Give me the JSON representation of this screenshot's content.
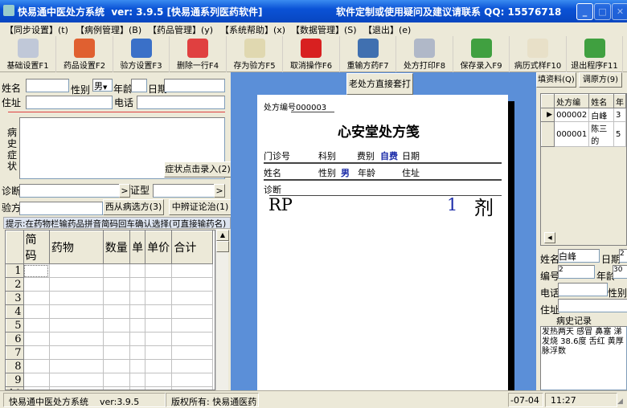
{
  "titlebar": {
    "title": "快易通中医处方系统  ver: 3.9.5 [快易通系列医药软件]",
    "contact": "软件定制或使用疑问及建议请联系 QQ: 15576718"
  },
  "menu": [
    "【同步设置】(t)",
    "【病例管理】(B)",
    "【药品管理】(y)",
    "【系统帮助】(x)",
    "【数据管理】(S)",
    "【退出】(e)"
  ],
  "toolbar": [
    {
      "label": "基础设置F1",
      "icon": "settings-icon",
      "color": "#c0c8d8"
    },
    {
      "label": "药品设置F2",
      "icon": "medicine-icon",
      "color": "#e06030"
    },
    {
      "label": "验方设置F3",
      "icon": "book-icon",
      "color": "#3a70c8"
    },
    {
      "label": "删除一行F4",
      "icon": "delete-row-icon",
      "color": "#e04040"
    },
    {
      "label": "存为验方F5",
      "icon": "save-note-icon",
      "color": "#e0d8b0"
    },
    {
      "label": "取消操作F6",
      "icon": "cancel-icon",
      "color": "#d82020"
    },
    {
      "label": "重输方药F7",
      "icon": "tools-icon",
      "color": "#4070b0"
    },
    {
      "label": "处方打印F8",
      "icon": "printer-icon",
      "color": "#b0b8c8"
    },
    {
      "label": "保存录入F9",
      "icon": "save-icon",
      "color": "#40a040"
    },
    {
      "label": "病历式样F10",
      "icon": "clipboard-icon",
      "color": "#e8e0c8"
    },
    {
      "label": "退出程序F11",
      "icon": "exit-arrow-icon",
      "color": "#40a040"
    }
  ],
  "form": {
    "name_label": "姓名",
    "sex_label": "性别",
    "sex_value": "男",
    "age_label": "年龄",
    "date_label": "日期",
    "address_label": "住址",
    "phone_label": "电话",
    "history_label": "病史症状",
    "symptom_button": "症状点击录入(2)",
    "diagnosis_label": "诊断",
    "syndrome_label": "证型",
    "recipe_label": "验方",
    "western_button": "西从病选方(3)",
    "tcm_button": "中辨证论治(1)",
    "hint": "提示:在药物栏输药品拼音简码回车确认选择(可直接输药名)"
  },
  "grid": {
    "columns": [
      "简码",
      "药物",
      "数量",
      "单",
      "单价",
      "合计"
    ],
    "rows": [
      "1",
      "2",
      "3",
      "4",
      "5",
      "6",
      "7",
      "8",
      "9",
      "10",
      "11"
    ]
  },
  "center": {
    "old_print_button": "老处方直接套打"
  },
  "paper": {
    "number_label": "处方编号",
    "number": "000003",
    "title": "心安堂处方笺",
    "clinic_label": "门诊号",
    "dept_label": "科别",
    "fee_label": "费别",
    "fee_value": "自费",
    "date_label": "日期",
    "name_label": "姓名",
    "sex_label": "性别",
    "sex_value": "男",
    "age_label": "年龄",
    "address_label": "住址",
    "diagnosis_label": "诊断",
    "rp": "RP",
    "dose_count": "1",
    "dose_unit": "剂"
  },
  "right": {
    "fill_button": "填资料(Q)",
    "recall_button": "调原方(9)",
    "list_columns": [
      "处方编",
      "姓名",
      "年"
    ],
    "list_rows": [
      [
        "000002",
        "白峰",
        "3"
      ],
      [
        "000001",
        "陈三的",
        "5"
      ]
    ],
    "name_label": "姓名",
    "name_value": "白峰",
    "date_label": "日期",
    "date_value": "2",
    "number_label": "编号",
    "number_value": "2",
    "age_label": "年龄",
    "age_value": "30",
    "phone_label": "电话",
    "sex_label": "性别",
    "address_label": "住址",
    "history_title": "病史记录",
    "history_text": "发热两天 感冒 鼻塞 涕 发烧 38.6度 舌红 黄厚 脉浮数"
  },
  "status": {
    "app": "快易通中医处方系统",
    "version": "ver:3.9.5",
    "copyright": "版权所有: 快易通医药",
    "date": "-07-04",
    "time": "11:27"
  }
}
